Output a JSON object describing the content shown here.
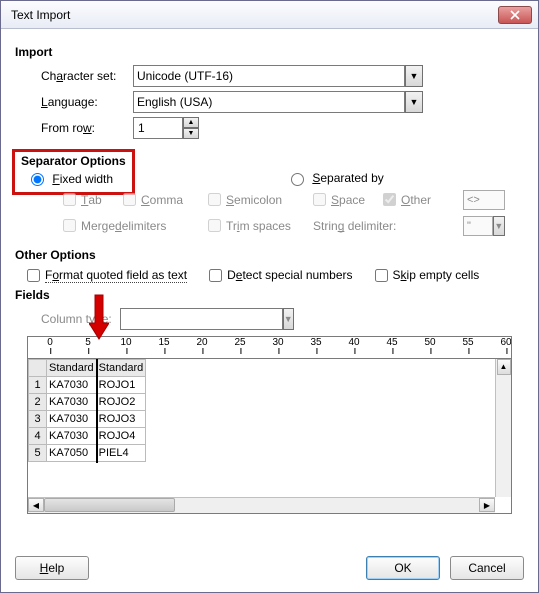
{
  "window": {
    "title": "Text Import"
  },
  "import": {
    "heading": "Import",
    "charset_label_pre": "Ch",
    "charset_label_u": "a",
    "charset_label_post": "racter set:",
    "charset_value": "Unicode (UTF-16)",
    "language_label_u": "L",
    "language_label_post": "anguage:",
    "language_value": "English (USA)",
    "fromrow_label_pre": "From ro",
    "fromrow_label_u": "w",
    "fromrow_label_post": ":",
    "fromrow_value": "1"
  },
  "separator": {
    "heading": "Separator Options",
    "fixed_u": "F",
    "fixed_post": "ixed width",
    "separated_u": "S",
    "separated_post": "eparated by",
    "tab_u": "T",
    "tab_post": "ab",
    "comma_u": "C",
    "comma_post": "omma",
    "semicolon_u": "S",
    "semicolon_post": "emicolon",
    "space_u": "S",
    "space_post": "pace",
    "other_u": "O",
    "other_post": "ther",
    "other_value": "<>",
    "merge_pre": "Merge ",
    "merge_u": "d",
    "merge_post": "elimiters",
    "trim_pre": "Tr",
    "trim_u": "i",
    "trim_post": "m spaces",
    "strdelim_pre": "Strin",
    "strdelim_u": "g",
    "strdelim_post": " delimiter:",
    "strdelim_value": "\""
  },
  "other": {
    "heading": "Other Options",
    "fmt_pre": "F",
    "fmt_u": "o",
    "fmt_post": "rmat quoted field as text",
    "detect_pre": "D",
    "detect_u": "e",
    "detect_post": "tect special numbers",
    "skip_pre": "S",
    "skip_u": "k",
    "skip_post": "ip empty cells"
  },
  "fields": {
    "heading": "Fields",
    "coltype_pre": "Column t",
    "coltype_u": "y",
    "coltype_post": "pe:",
    "col_header": "Standard",
    "ruler_ticks": [
      "0",
      "5",
      "10",
      "15",
      "20",
      "25",
      "30",
      "35",
      "40",
      "45",
      "50",
      "55",
      "60"
    ],
    "rows": [
      {
        "n": "1",
        "c1": "KA7030",
        "c2": "ROJO1"
      },
      {
        "n": "2",
        "c1": "KA7030",
        "c2": "ROJO2"
      },
      {
        "n": "3",
        "c1": "KA7030",
        "c2": "ROJO3"
      },
      {
        "n": "4",
        "c1": "KA7030",
        "c2": "ROJO4"
      },
      {
        "n": "5",
        "c1": "KA7050",
        "c2": "PIEL4"
      }
    ]
  },
  "buttons": {
    "help_u": "H",
    "help_post": "elp",
    "ok": "OK",
    "cancel": "Cancel"
  }
}
